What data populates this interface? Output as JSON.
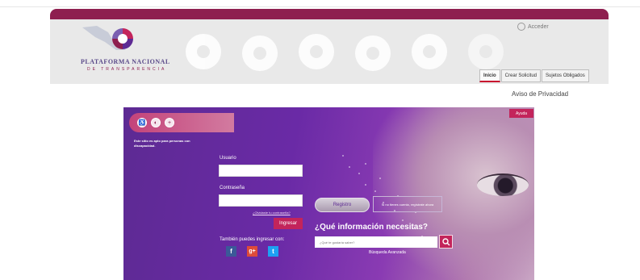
{
  "header": {
    "logo_title": "PLATAFORMA NACIONAL",
    "logo_subtitle": "DE TRANSPARENCIA",
    "acceder": "Acceder",
    "tabs": [
      {
        "label": "Inicio",
        "active": true
      },
      {
        "label": "Crear Solicitud",
        "active": false
      },
      {
        "label": "Sujetos Obligados",
        "active": false
      }
    ],
    "aviso": "Aviso de Privacidad"
  },
  "panel": {
    "ayuda": "Ayuda",
    "accessibility_note": "Este sitio es apto para personas con discapacidad.",
    "usuario_label": "Usuario",
    "contrasena_label": "Contraseña",
    "forgot": "¿Olvidaste tu contraseña?",
    "ingresar": "Ingresar",
    "also_login": "También puedes ingresar con:",
    "registro": "Registro",
    "no_cuenta": "Si no tienes cuenta, regístrate ahora",
    "question": "¿Qué información necesitas?",
    "search_placeholder": "¿Qué te gustaría saber?",
    "advanced_search": "Búsqueda Avanzada"
  },
  "colors": {
    "brand": "#8e1f4f",
    "accent": "#c3245b",
    "panel": "#6a2aa6"
  },
  "icons": [
    "user-icon",
    "accessibility-icon",
    "contrast-icon",
    "zoom-icon",
    "facebook-icon",
    "google-plus-icon",
    "twitter-icon",
    "search-icon"
  ]
}
